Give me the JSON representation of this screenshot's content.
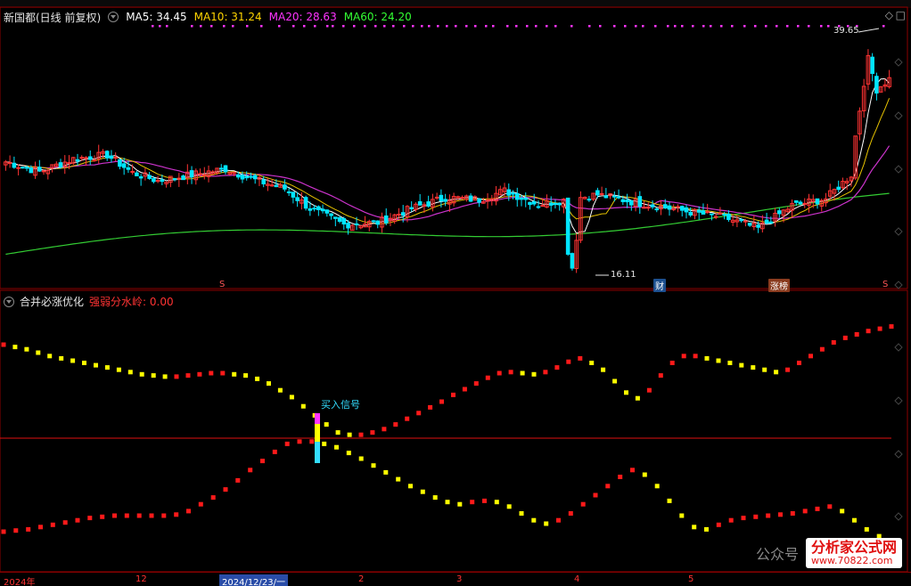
{
  "header": {
    "stock": "新国都(日线 前复权)",
    "ma5_label": "MA5: 34.45",
    "ma10_label": "MA10: 31.24",
    "ma20_label": "MA20: 28.63",
    "ma60_label": "MA60: 24.20"
  },
  "price_panel": {
    "high_label": "39.65",
    "low_label": "16.11",
    "cai_badge": "财",
    "zhangting_badge": "涨榜",
    "s_marker": "S"
  },
  "indicator_panel": {
    "title": "合并必涨优化",
    "value_label": "强弱分水岭: 0.00",
    "buy_signal": "买入信号"
  },
  "xaxis": {
    "year": "2024年",
    "m12": "12",
    "highlight": "2024/12/23/一",
    "m2": "2",
    "m3": "3",
    "m4": "4",
    "m5": "5"
  },
  "watermark": {
    "gzh": "公众号",
    "brand": "分析家公式网",
    "url": "www.70822.com"
  },
  "chart_data": [
    {
      "type": "candlestick",
      "title": "新国都(日线 前复权)",
      "series": [
        {
          "name": "MA5",
          "color": "#ffffff"
        },
        {
          "name": "MA10",
          "color": "#ffd400"
        },
        {
          "name": "MA20",
          "color": "#ff33ff"
        },
        {
          "name": "MA60",
          "color": "#33ff33"
        }
      ],
      "annotations": {
        "high": 39.65,
        "low": 16.11
      },
      "colors": {
        "up": "#ff3333",
        "down": "#00e5ff"
      }
    },
    {
      "type": "line",
      "title": "合并必涨优化",
      "baseline": 0.0,
      "series": [
        {
          "name": "upper",
          "values": [
            0.82,
            0.8,
            0.78,
            0.75,
            0.72,
            0.7,
            0.68,
            0.66,
            0.64,
            0.62,
            0.6,
            0.58,
            0.56,
            0.55,
            0.54,
            0.54,
            0.55,
            0.56,
            0.57,
            0.57,
            0.56,
            0.55,
            0.52,
            0.48,
            0.42,
            0.36,
            0.28,
            0.2,
            0.12,
            0.05,
            0.03,
            0.03,
            0.05,
            0.08,
            0.12,
            0.17,
            0.22,
            0.27,
            0.32,
            0.38,
            0.43,
            0.48,
            0.53,
            0.57,
            0.58,
            0.57,
            0.56,
            0.58,
            0.62,
            0.67,
            0.7,
            0.66,
            0.6,
            0.5,
            0.4,
            0.35,
            0.42,
            0.55,
            0.66,
            0.72,
            0.72,
            0.7,
            0.68,
            0.66,
            0.64,
            0.62,
            0.6,
            0.58,
            0.6,
            0.66,
            0.72,
            0.78,
            0.84,
            0.88,
            0.91,
            0.94,
            0.96,
            0.98
          ]
        },
        {
          "name": "lower",
          "values": [
            -0.82,
            -0.81,
            -0.8,
            -0.78,
            -0.76,
            -0.74,
            -0.72,
            -0.7,
            -0.69,
            -0.68,
            -0.68,
            -0.68,
            -0.68,
            -0.68,
            -0.67,
            -0.64,
            -0.58,
            -0.52,
            -0.45,
            -0.37,
            -0.28,
            -0.2,
            -0.12,
            -0.05,
            -0.03,
            -0.03,
            -0.05,
            -0.08,
            -0.13,
            -0.18,
            -0.24,
            -0.3,
            -0.36,
            -0.42,
            -0.47,
            -0.52,
            -0.56,
            -0.58,
            -0.56,
            -0.55,
            -0.56,
            -0.6,
            -0.66,
            -0.72,
            -0.75,
            -0.72,
            -0.66,
            -0.58,
            -0.5,
            -0.42,
            -0.34,
            -0.28,
            -0.32,
            -0.42,
            -0.55,
            -0.68,
            -0.78,
            -0.8,
            -0.76,
            -0.72,
            -0.7,
            -0.69,
            -0.68,
            -0.67,
            -0.66,
            -0.64,
            -0.62,
            -0.6,
            -0.64,
            -0.72,
            -0.8,
            -0.86,
            -0.9
          ]
        }
      ],
      "colors": {
        "rising": "#ff1a1a",
        "falling": "#ffff00"
      }
    }
  ]
}
